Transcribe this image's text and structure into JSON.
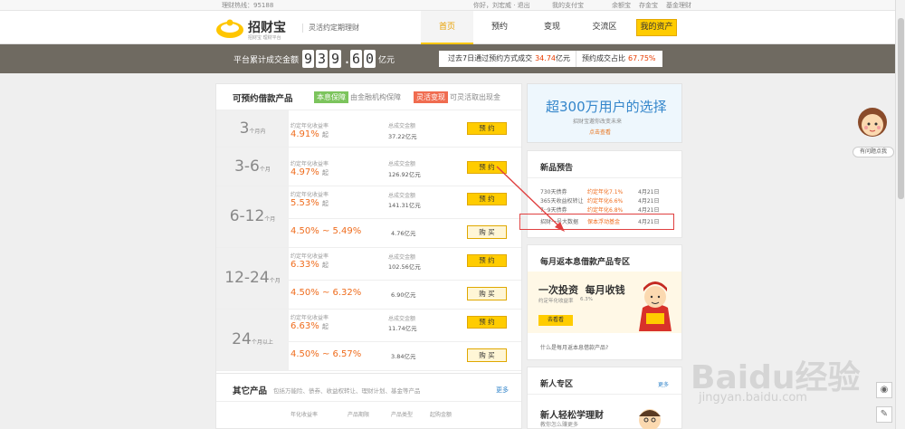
{
  "topbar": {
    "hotline": "理财热线：95188",
    "links": "你好，刘宏威 · 退出",
    "right_links": [
      "余额宝",
      "存金宝",
      "基金理财"
    ],
    "mid_link": "我的支付宝"
  },
  "header": {
    "logo_name": "招财宝",
    "logo_sub": "招财宝 理财平台",
    "slogan": "灵活约定期理财",
    "nav": [
      "首页",
      "预约",
      "变现",
      "交流区"
    ],
    "active_nav": 0,
    "my_asset": "我的资产"
  },
  "stats": {
    "label": "平台累计成交金额",
    "digits": [
      "9",
      "3",
      "9",
      ".",
      "6",
      "0"
    ],
    "unit": "亿元",
    "box_left_pre": "过去7日通过预约方式成交",
    "box_left_val": "34.74",
    "box_left_unit": "亿元",
    "box_right_pre": "预约成交占比",
    "box_right_val": "67.75%"
  },
  "products": {
    "title": "可预约借款产品",
    "tag1": "本息保障",
    "tag1_desc": "由金融机构保障",
    "tag2": "灵活变现",
    "tag2_desc": "可灵活取出现金",
    "rate_label": "约定年化收益率",
    "amt_label": "总成交金额",
    "unit_qi": "起",
    "btn_reserve": "预 约",
    "btn_buy": "购 买",
    "rows": [
      {
        "term": "3",
        "term_unit": "个月内",
        "rate": "4.91%",
        "amount": "37.22亿元"
      },
      {
        "term": "3-6",
        "term_unit": "个月",
        "rate": "4.97%",
        "amount": "126.92亿元"
      },
      {
        "term": "6-12",
        "term_unit": "个月",
        "rate": "5.53%",
        "amount": "141.31亿元",
        "buy_range": "4.50% ~ 5.49%",
        "buy_amount": "4.76亿元"
      },
      {
        "term": "12-24",
        "term_unit": "个月",
        "rate": "6.33%",
        "amount": "102.56亿元",
        "buy_range": "4.50% ~ 6.32%",
        "buy_amount": "6.90亿元"
      },
      {
        "term": "24",
        "term_unit": "个月以上",
        "rate": "6.63%",
        "amount": "11.74亿元",
        "buy_range": "4.50% ~ 6.57%",
        "buy_amount": "3.84亿元"
      }
    ]
  },
  "others": {
    "title": "其它产品",
    "desc": "包括万能险、债券、收益权转让、理财计划、基金等产品",
    "more": "更多",
    "cols": [
      "年化收益率",
      "产品期限",
      "产品类型",
      "起购金额"
    ]
  },
  "banner": {
    "title": "超300万用户的选择",
    "sub": "招财宝邀你改变未来",
    "link": "点击查看"
  },
  "preview": {
    "title": "新品预告",
    "items": [
      {
        "name": "730天债券",
        "rate": "约定年化7.1%",
        "date": "4月21日"
      },
      {
        "name": "365天收益权转让",
        "rate": "约定年化6.6%",
        "date": "4月21日"
      },
      {
        "name": "7··9天债券",
        "rate": "约定年化6.8%",
        "date": "4月21日"
      },
      {
        "name": "招财一号大数据",
        "rate": "保本浮动基金",
        "date": "4月21日"
      }
    ]
  },
  "monthly": {
    "title": "每月返本息借款产品专区",
    "headline": "一次投资  每月收钱",
    "sub": "约定年化收益率",
    "sub_val": "6.3%",
    "btn": "去看看",
    "question": "什么是每月返本息借款产品?"
  },
  "newbie": {
    "title": "新人专区",
    "more": "更多",
    "headline": "新人轻松学理财",
    "sub": "教你怎么赚更多"
  },
  "mascot": {
    "label": "有问题点我"
  },
  "watermark": {
    "main": "Baidu经验",
    "sub": "jingyan.baidu.com"
  },
  "colors": {
    "accent": "#ffcc00",
    "rate": "#ef6c1d",
    "stats_bg": "#6f6a61",
    "annotation": "#e04040"
  }
}
